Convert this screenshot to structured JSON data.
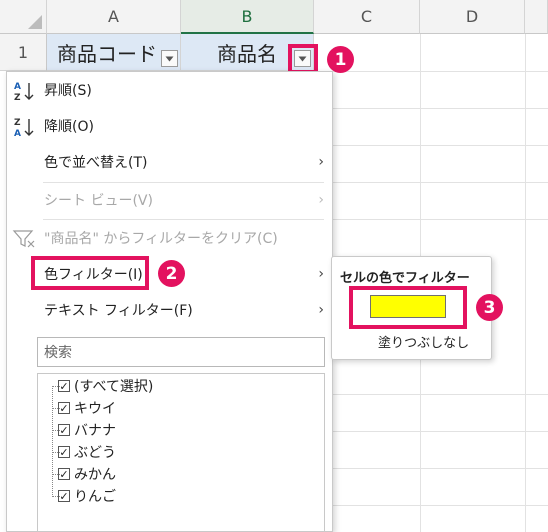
{
  "columns": [
    "A",
    "B",
    "C",
    "D"
  ],
  "row_number": "1",
  "cells": {
    "a1": "商品コード",
    "b1": "商品名"
  },
  "menu": {
    "items": [
      {
        "label": "昇順(S)",
        "icon": "sort-ascending-icon"
      },
      {
        "label": "降順(O)",
        "icon": "sort-descending-icon"
      },
      {
        "label": "色で並べ替え(T)",
        "submenu": true
      },
      {
        "label": "シート ビュー(V)",
        "submenu": true,
        "disabled": true
      },
      {
        "label": "\"商品名\" からフィルターをクリア(C)",
        "icon": "clear-filter-icon",
        "disabled": true
      },
      {
        "label": "色フィルター(I)",
        "submenu": true
      },
      {
        "label": "テキスト フィルター(F)",
        "submenu": true
      }
    ],
    "search_placeholder": "検索",
    "list": [
      "(すべて選択)",
      "キウイ",
      "バナナ",
      "ぶどう",
      "みかん",
      "りんご"
    ]
  },
  "submenu": {
    "title": "セルの色でフィルター",
    "swatch_color": "#ffff00",
    "no_fill": "塗りつぶしなし"
  },
  "annotations": [
    "1",
    "2",
    "3"
  ],
  "accent": "#e3125f"
}
